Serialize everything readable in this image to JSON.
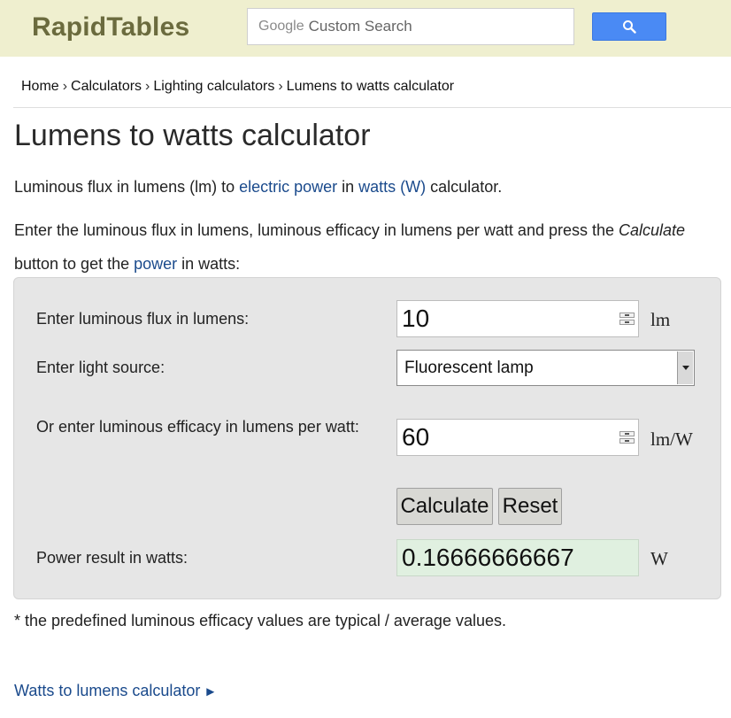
{
  "header": {
    "logo": "RapidTables",
    "search_brand": "Google",
    "search_placeholder": "Custom Search",
    "search_icon": "search-icon"
  },
  "breadcrumb": [
    "Home",
    "Calculators",
    "Lighting calculators",
    "Lumens to watts calculator"
  ],
  "page": {
    "title": "Lumens to watts calculator",
    "intro_1": "Luminous flux in lumens (lm) to ",
    "intro_link_1": "electric power",
    "intro_2": " in ",
    "intro_link_2": "watts (W)",
    "intro_3": " calculator.",
    "instr_1": "Enter the luminous flux in lumens, luminous efficacy in lumens per watt and press the ",
    "instr_em": "Calculate",
    "instr_2": " button to get the ",
    "instr_link": "power",
    "instr_3": " in watts:"
  },
  "calculator": {
    "flux_label": "Enter luminous flux in lumens:",
    "flux_value": "10",
    "flux_unit": "lm",
    "source_label": "Enter light source:",
    "source_value": "Fluorescent lamp",
    "efficacy_label": "Or enter luminous efficacy in lumens per watt:",
    "efficacy_value": "60",
    "efficacy_unit": "lm/W",
    "calculate_label": "Calculate",
    "reset_label": "Reset",
    "result_label": "Power result in watts:",
    "result_value": "0.16666666667",
    "result_unit": "W"
  },
  "footnote": "* the predefined luminous efficacy values are typical / average values.",
  "next_link": "Watts to lumens calculator",
  "colors": {
    "header_bg": "#efefcf",
    "logo": "#6b6b3e",
    "search_button": "#4a8af4",
    "link": "#1a4a8c",
    "panel_bg": "#e6e6e6",
    "result_bg": "#e0f0e0"
  }
}
